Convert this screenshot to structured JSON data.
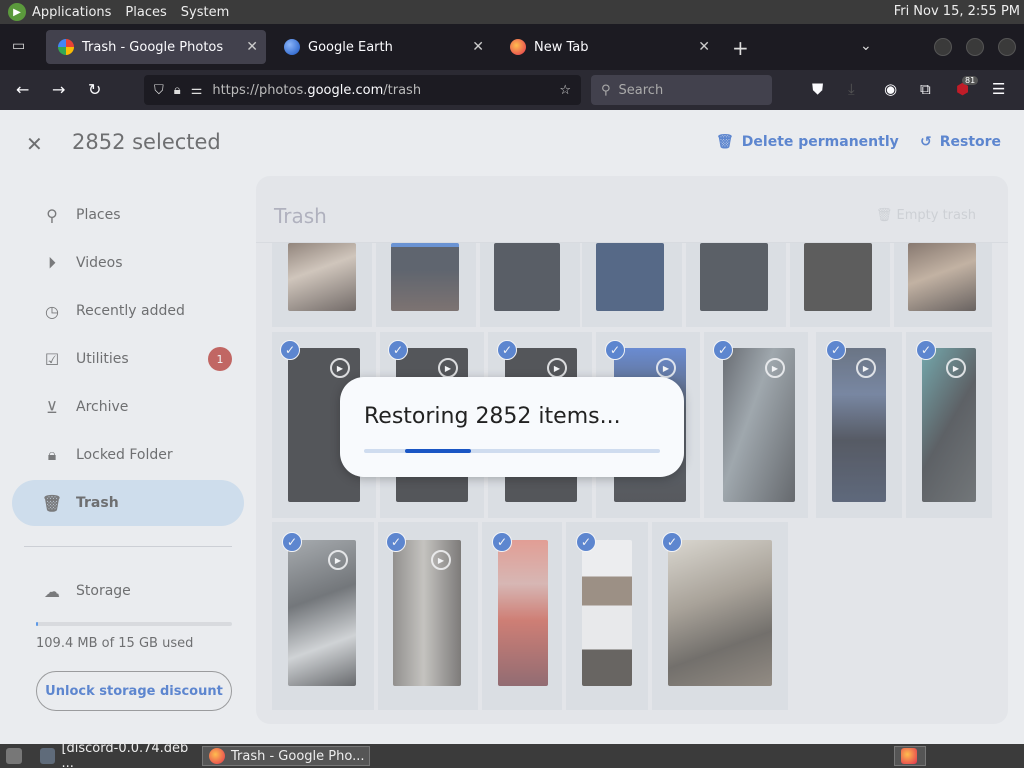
{
  "topbar": {
    "menus": [
      "Applications",
      "Places",
      "System"
    ],
    "clock": "Fri Nov 15,  2:55 PM"
  },
  "tabs": [
    {
      "title": "Trash - Google Photos",
      "active": true
    },
    {
      "title": "Google Earth",
      "active": false
    },
    {
      "title": "New Tab",
      "active": false
    }
  ],
  "navbar": {
    "url_prefix": "https://photos.",
    "url_host": "google.com",
    "url_path": "/trash",
    "search_placeholder": "Search",
    "ublock_count": "81"
  },
  "selection": {
    "count_label": "2852 selected",
    "delete_label": "Delete permanently",
    "restore_label": "Restore"
  },
  "sidebar": {
    "items": [
      {
        "label": "Places",
        "icon": "place-pin-icon"
      },
      {
        "label": "Videos",
        "icon": "play-circle-icon"
      },
      {
        "label": "Recently added",
        "icon": "clock-icon"
      },
      {
        "label": "Utilities",
        "icon": "checklist-icon",
        "badge": "1"
      },
      {
        "label": "Archive",
        "icon": "archive-icon"
      },
      {
        "label": "Locked Folder",
        "icon": "lock-icon"
      },
      {
        "label": "Trash",
        "icon": "trash-icon",
        "active": true
      }
    ],
    "storage_label": "Storage",
    "storage_used": "109.4 MB of 15 GB used",
    "storage_fraction": 0.007,
    "unlock_label": "Unlock storage discount"
  },
  "main": {
    "title": "Trash",
    "empty_trash_label": "Empty trash"
  },
  "dialog": {
    "text": "Restoring 2852 items...",
    "progress_start": 0.14,
    "progress_end": 0.36
  },
  "taskbar": {
    "items": [
      {
        "label": "[discord-0.0.74.deb ..."
      },
      {
        "label": "Trash - Google Pho...",
        "active": true
      }
    ]
  },
  "colors": {
    "accent": "#1a56c4",
    "badge": "#b3261e",
    "active_nav": "#c7dcf0"
  }
}
